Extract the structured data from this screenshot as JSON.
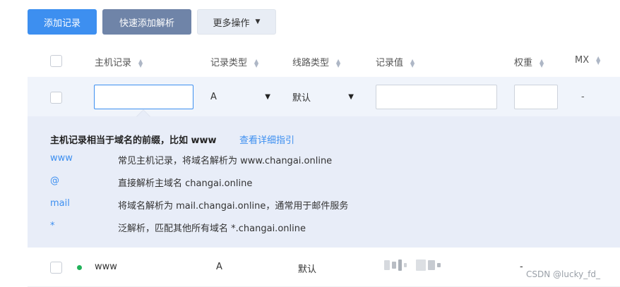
{
  "toolbar": {
    "add_label": "添加记录",
    "quick_add_label": "快速添加解析",
    "more_label": "更多操作",
    "more_caret": "▼"
  },
  "table": {
    "columns": [
      "主机记录",
      "记录类型",
      "线路类型",
      "记录值",
      "权重",
      "MX"
    ],
    "sort_icon": "sort-icon"
  },
  "edit_row": {
    "host_value": "",
    "type_value": "A",
    "line_value": "默认",
    "record_value": "",
    "weight_value": "",
    "mx_value": "-",
    "dropdown_caret": "▼"
  },
  "tip": {
    "title": "主机记录相当于域名的前缀，比如 www",
    "link": "查看详细指引",
    "items": [
      {
        "key": "www",
        "desc": "常见主机记录，将域名解析为 www.changai.online"
      },
      {
        "key": "@",
        "desc": "直接解析主域名 changai.online"
      },
      {
        "key": "mail",
        "desc": "将域名解析为 mail.changai.online，通常用于邮件服务"
      },
      {
        "key": "*",
        "desc": "泛解析，匹配其他所有域名 *.changai.online"
      }
    ]
  },
  "rows": [
    {
      "host": "www",
      "type": "A",
      "line": "默认",
      "value": "",
      "mx": "-",
      "status_color": "#22b25a"
    }
  ],
  "watermark": "CSDN @lucky_fd_",
  "colors": {
    "accent": "#3d8ff0",
    "secondary_button": "#6f84a8",
    "tip_bg": "#e8edf8",
    "row_highlight": "#f0f4fb"
  }
}
